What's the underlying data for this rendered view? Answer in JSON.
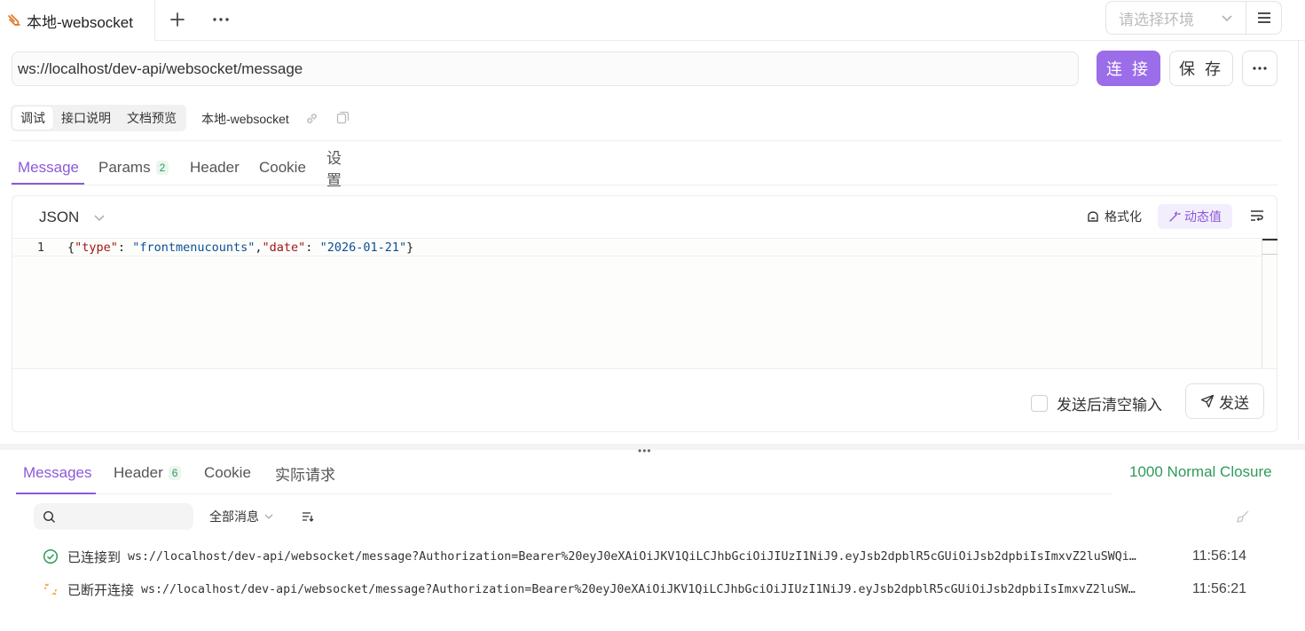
{
  "tabbar": {
    "active_tab_title": "本地-websocket",
    "env_placeholder": "请选择环境"
  },
  "request": {
    "url": "ws://localhost/dev-api/websocket/message",
    "connect_label": "连 接",
    "save_label": "保 存"
  },
  "mode": {
    "segments": [
      "调试",
      "接口说明",
      "文档预览"
    ],
    "active_segment": "调试",
    "api_name": "本地-websocket"
  },
  "req_tabs": {
    "items": [
      {
        "label": "Message"
      },
      {
        "label": "Params",
        "badge": "2"
      },
      {
        "label": "Header"
      },
      {
        "label": "Cookie"
      },
      {
        "label": "设置"
      }
    ],
    "active": "Message"
  },
  "editor": {
    "format": "JSON",
    "format_btn": "格式化",
    "dynamic_btn": "动态值",
    "line_number": "1",
    "code": "{\"type\": \"frontmenucounts\",\"date\": \"2026-01-21\"}",
    "clear_after_send_label": "发送后清空输入",
    "send_label": "发送"
  },
  "response": {
    "tabs": [
      {
        "label": "Messages"
      },
      {
        "label": "Header",
        "badge": "6"
      },
      {
        "label": "Cookie"
      },
      {
        "label": "实际请求"
      }
    ],
    "active": "Messages",
    "closure_status": "1000 Normal Closure",
    "filter_label": "全部消息",
    "messages": [
      {
        "status": "connected",
        "label": "已连接到",
        "url": "ws://localhost/dev-api/websocket/message?Authorization=Bearer%20eyJ0eXAiOiJKV1QiLCJhbGciOiJIUzI1NiJ9.eyJsb2dpblR5cGUiOiJsb2dpbiIsImxvZ2luSWQi…",
        "time": "11:56:14"
      },
      {
        "status": "disconnected",
        "label": "已断开连接",
        "url": "ws://localhost/dev-api/websocket/message?Authorization=Bearer%20eyJ0eXAiOiJKV1QiLCJhbGciOiJIUzI1NiJ9.eyJsb2dpblR5cGUiOiJsb2dpbiIsImxvZ2luSW…",
        "time": "11:56:21"
      }
    ]
  },
  "colors": {
    "accent": "#8b5ad8",
    "connect_bg": "#9b6de8",
    "success": "#2f9b5a",
    "warning": "#f0a030"
  },
  "icons": {
    "tab": "websocket-icon",
    "add": "plus-icon",
    "more": "ellipsis-icon",
    "env_menu": "hamburger-icon",
    "link": "link-icon",
    "copy": "copy-icon",
    "format": "format-icon",
    "dynamic": "magic-wand-icon",
    "wrap": "wrap-lines-icon",
    "send": "paper-plane-icon",
    "search": "search-icon",
    "sort": "sort-icon",
    "clear": "broom-icon",
    "connected": "check-circle-icon",
    "disconnected": "broken-link-icon"
  }
}
